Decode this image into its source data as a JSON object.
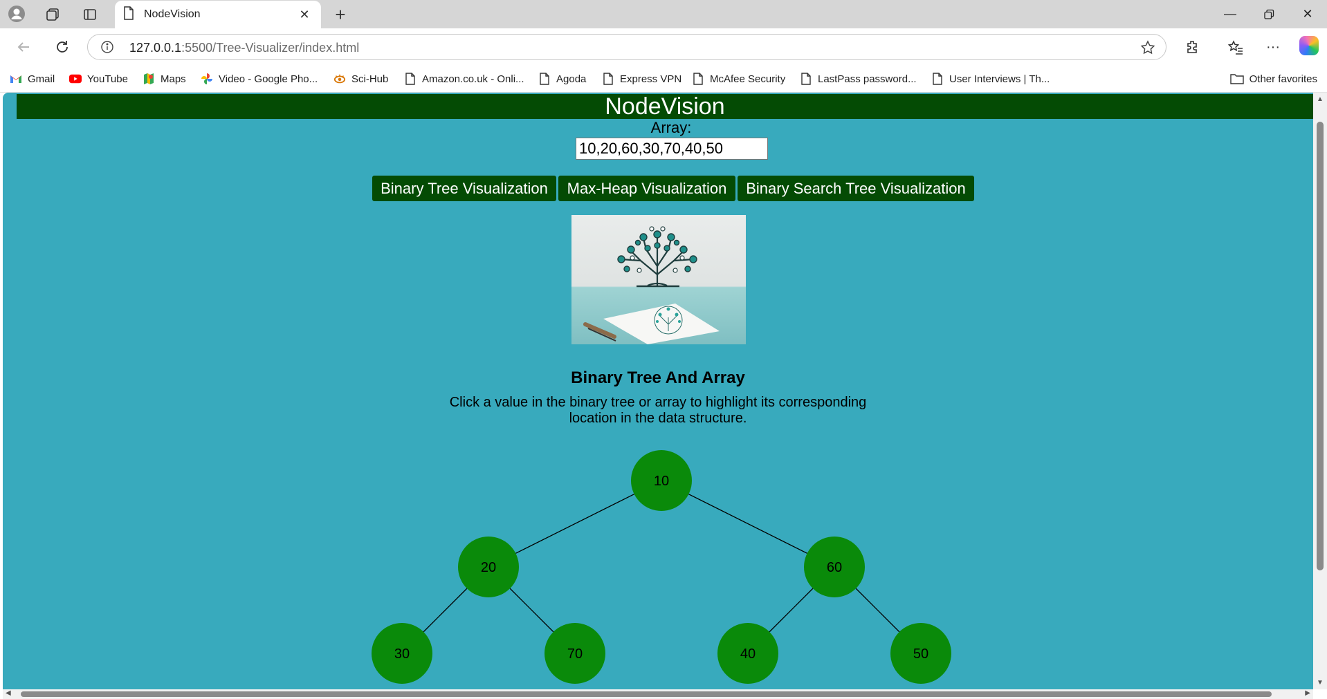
{
  "browser": {
    "tab_title": "NodeVision",
    "url_host": "127.0.0.1",
    "url_rest": ":5500/Tree-Visualizer/index.html",
    "bookmarks": [
      {
        "label": "Gmail",
        "icon": "gmail-icon"
      },
      {
        "label": "YouTube",
        "icon": "youtube-icon"
      },
      {
        "label": "Maps",
        "icon": "maps-icon"
      },
      {
        "label": "Video - Google Pho...",
        "icon": "photos-icon"
      },
      {
        "label": "Sci-Hub",
        "icon": "scihub-icon"
      },
      {
        "label": "Amazon.co.uk - Onli...",
        "icon": "page-icon"
      },
      {
        "label": "Agoda",
        "icon": "page-icon"
      },
      {
        "label": "Express VPN",
        "icon": "page-icon"
      },
      {
        "label": "McAfee Security",
        "icon": "page-icon"
      },
      {
        "label": "LastPass password...",
        "icon": "page-icon"
      },
      {
        "label": "User Interviews | Th...",
        "icon": "page-icon"
      }
    ],
    "other_favorites": "Other favorites"
  },
  "page": {
    "header_title": "NodeVision",
    "array_label": "Array:",
    "array_value": "10,20,60,30,70,40,50",
    "buttons": [
      "Binary Tree Visualization",
      "Max-Heap Visualization",
      "Binary Search Tree Visualization"
    ],
    "section_title": "Binary Tree And Array",
    "instructions": "Click a value in the binary tree or array to highlight its corresponding location in the data structure.",
    "tree_nodes": [
      "10",
      "20",
      "60",
      "30",
      "70",
      "40",
      "50"
    ]
  },
  "colors": {
    "page_background": "#38aabd",
    "header_green": "#044b04",
    "node_green": "#0a8a0a"
  }
}
